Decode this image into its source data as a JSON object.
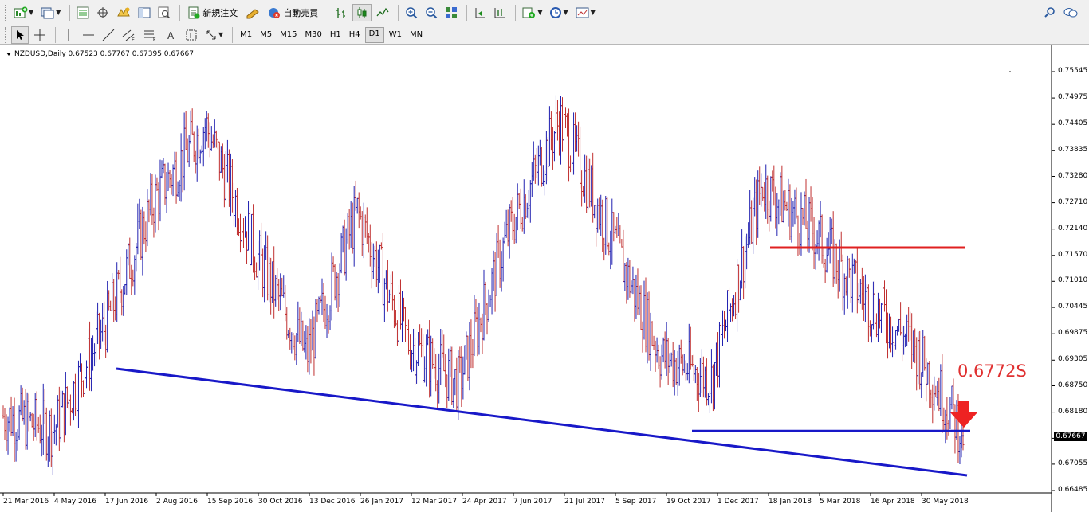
{
  "toolbar": {
    "new_order_label": "新規注文",
    "auto_trade_label": "自動売買"
  },
  "timeframes": [
    "M1",
    "M5",
    "M15",
    "M30",
    "H1",
    "H4",
    "D1",
    "W1",
    "MN"
  ],
  "active_timeframe": "D1",
  "chart": {
    "symbol_info": "NZDUSD,Daily  0.67523 0.67767 0.67395 0.67667",
    "current_price": "0.67667",
    "annotation": "0.6772S",
    "colors": {
      "up_bar": "#2020b0",
      "down_bar": "#c03030",
      "support_line": "#1818c8",
      "resistance_line": "#e02020",
      "annotation": "#e03030"
    }
  },
  "chart_data": {
    "type": "ohlc",
    "symbol": "NZDUSD",
    "timeframe": "Daily",
    "last_bar": {
      "open": 0.67523,
      "high": 0.67767,
      "low": 0.67395,
      "close": 0.67667
    },
    "y_ticks": [
      "0.75545",
      "0.74975",
      "0.74405",
      "0.73835",
      "0.73280",
      "0.72710",
      "0.72140",
      "0.71570",
      "0.71010",
      "0.70445",
      "0.69875",
      "0.69305",
      "0.68750",
      "0.68180",
      "0.67615",
      "0.67055",
      "0.66485"
    ],
    "x_ticks": [
      "21 Mar 2016",
      "4 May 2016",
      "17 Jun 2016",
      "2 Aug 2016",
      "15 Sep 2016",
      "30 Oct 2016",
      "13 Dec 2016",
      "26 Jan 2017",
      "12 Mar 2017",
      "24 Apr 2017",
      "7 Jun 2017",
      "21 Jul 2017",
      "5 Sep 2017",
      "19 Oct 2017",
      "1 Dec 2017",
      "18 Jan 2018",
      "5 Mar 2018",
      "16 Apr 2018",
      "30 May 2018"
    ],
    "ylim": [
      0.66485,
      0.75545
    ],
    "approx_close_path": [
      {
        "date": "21 Mar 2016",
        "value": 0.681
      },
      {
        "date": "4 May 2016",
        "value": 0.678
      },
      {
        "date": "17 Jun 2016",
        "value": 0.7
      },
      {
        "date": "2 Aug 2016",
        "value": 0.728
      },
      {
        "date": "15 Sep 2016",
        "value": 0.744
      },
      {
        "date": "30 Oct 2016",
        "value": 0.716
      },
      {
        "date": "13 Dec 2016",
        "value": 0.694
      },
      {
        "date": "26 Jan 2017",
        "value": 0.725
      },
      {
        "date": "12 Mar 2017",
        "value": 0.697
      },
      {
        "date": "24 Apr 2017",
        "value": 0.688
      },
      {
        "date": "7 Jun 2017",
        "value": 0.721
      },
      {
        "date": "21 Jul 2017",
        "value": 0.745
      },
      {
        "date": "5 Sep 2017",
        "value": 0.72
      },
      {
        "date": "19 Oct 2017",
        "value": 0.694
      },
      {
        "date": "1 Dec 2017",
        "value": 0.689
      },
      {
        "date": "18 Jan 2018",
        "value": 0.731
      },
      {
        "date": "5 Mar 2018",
        "value": 0.721
      },
      {
        "date": "16 Apr 2018",
        "value": 0.707
      },
      {
        "date": "30 May 2018",
        "value": 0.696
      },
      {
        "date": "end",
        "value": 0.67667
      }
    ]
  }
}
